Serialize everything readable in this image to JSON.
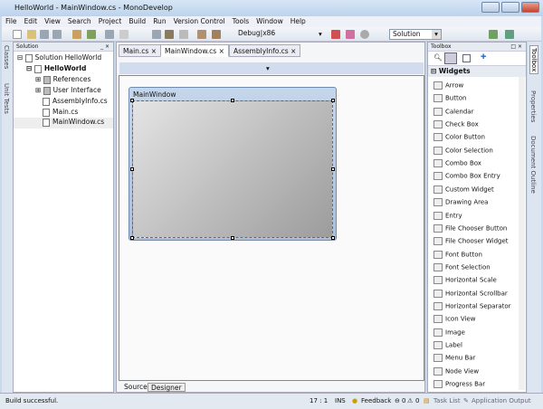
{
  "window": {
    "title": "HelloWorld - MainWindow.cs - MonoDevelop"
  },
  "menu": [
    "File",
    "Edit",
    "View",
    "Search",
    "Project",
    "Build",
    "Run",
    "Version Control",
    "Tools",
    "Window",
    "Help"
  ],
  "toolbar": {
    "config": "Debug|x86",
    "scope": "Solution"
  },
  "leftstrip": {
    "classes": "Classes",
    "unit_tests": "Unit Tests"
  },
  "solution": {
    "title": "Solution",
    "root": "Solution HelloWorld",
    "project": "HelloWorld",
    "items": [
      "References",
      "User Interface",
      "AssemblyInfo.cs",
      "Main.cs",
      "MainWindow.cs"
    ]
  },
  "tabs": [
    "Main.cs",
    "MainWindow.cs",
    "AssemblyInfo.cs"
  ],
  "designer": {
    "window_title": "MainWindow",
    "source_tab": "Source",
    "designer_tab": "Designer"
  },
  "toolbox": {
    "title": "Toolbox",
    "category": "Widgets",
    "items": [
      "Arrow",
      "Button",
      "Calendar",
      "Check Box",
      "Color Button",
      "Color Selection",
      "Combo Box",
      "Combo Box Entry",
      "Custom Widget",
      "Drawing Area",
      "Entry",
      "File Chooser Button",
      "File Chooser Widget",
      "Font Button",
      "Font Selection",
      "Horizontal Scale",
      "Horizontal Scrollbar",
      "Horizontal Separator",
      "Icon View",
      "Image",
      "Label",
      "Menu Bar",
      "Node View",
      "Progress Bar"
    ]
  },
  "rightstrip": {
    "toolbox": "Toolbox",
    "properties": "Properties",
    "outline": "Document Outline"
  },
  "status": {
    "message": "Build successful.",
    "position": "17 : 1",
    "mode": "INS",
    "feedback": "Feedback",
    "errors": "0",
    "warnings": "0",
    "task_list": "Task List",
    "app_output": "Application Output"
  }
}
